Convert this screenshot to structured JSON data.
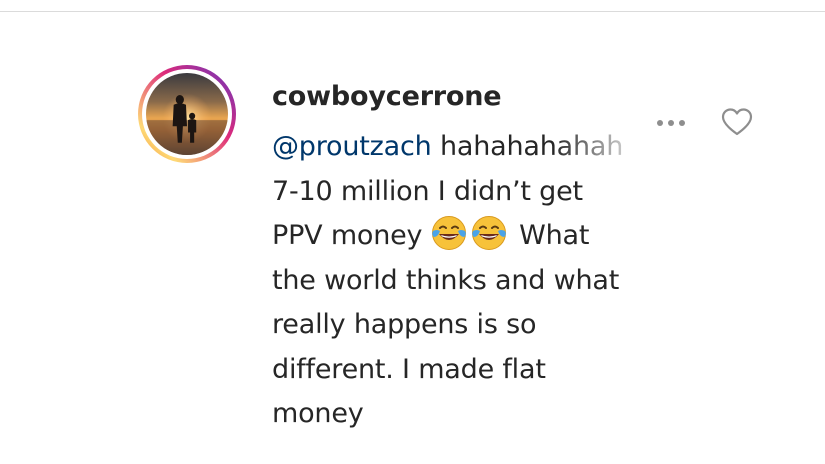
{
  "comment": {
    "username": "cowboycerrone",
    "mention": "@proutzach",
    "line1_rest": "hahahahah",
    "line1_fade": "ah",
    "line2": "7-10 million I didn’t get",
    "line3_before": "PPV money",
    "line3_after": "What",
    "line4": "the world thinks and what",
    "line5": "really happens is so",
    "line6": "different. I made flat",
    "line7": "money",
    "emojis": [
      "face-with-tears-of-joy",
      "face-with-tears-of-joy"
    ]
  },
  "actions": {
    "more_icon": "ellipsis-icon",
    "like_icon": "heart-outline-icon"
  },
  "colors": {
    "text": "#262626",
    "mention": "#00376b",
    "icon_gray": "#8e8e8e",
    "story_ring": [
      "#f58529",
      "#dd2a7b",
      "#8134af"
    ]
  }
}
